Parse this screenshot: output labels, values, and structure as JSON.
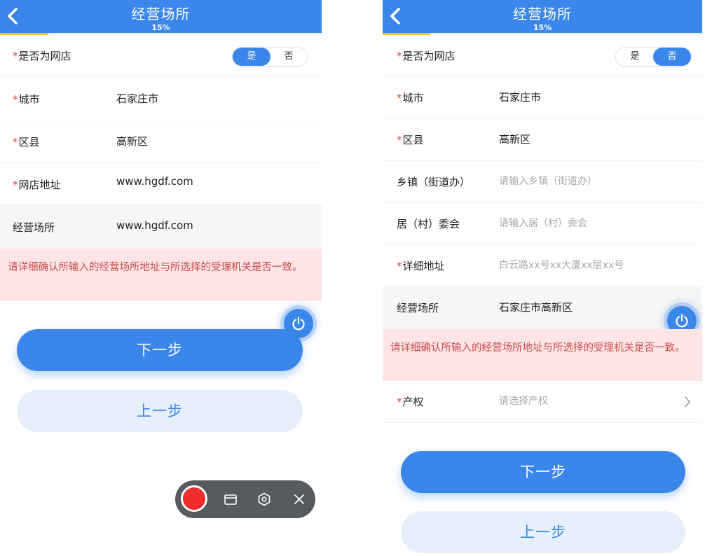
{
  "left": {
    "header": {
      "title": "经营场所",
      "progress_text": "15%",
      "progress_value": 0.15
    },
    "online_store": {
      "label": "是否为网店",
      "options": [
        "是",
        "否"
      ],
      "selected": "是"
    },
    "rows": [
      {
        "label": "城市",
        "required": true,
        "value": "石家庄市"
      },
      {
        "label": "区县",
        "required": true,
        "value": "高新区"
      },
      {
        "label": "网店地址",
        "required": true,
        "value": "www.hgdf.com"
      },
      {
        "label": "经营场所",
        "required": false,
        "value": "www.hgdf.com"
      }
    ],
    "warning": "请详细确认所输入的经营场所地址与所选择的受理机关是否一致。",
    "buttons": {
      "next": "下一步",
      "prev": "上一步"
    }
  },
  "right": {
    "header": {
      "title": "经营场所",
      "progress_text": "15%",
      "progress_value": 0.15
    },
    "online_store": {
      "label": "是否为网店",
      "options": [
        "是",
        "否"
      ],
      "selected": "否"
    },
    "rows": [
      {
        "label": "城市",
        "required": true,
        "value": "石家庄市"
      },
      {
        "label": "区县",
        "required": true,
        "value": "高新区"
      },
      {
        "label": "乡镇（街道办）",
        "required": false,
        "placeholder": "请输入乡镇（街道办）"
      },
      {
        "label": "居（村）委会",
        "required": false,
        "placeholder": "请输入居（村）委会"
      },
      {
        "label": "详细地址",
        "required": true,
        "placeholder": "白云路xx号xx大厦xx层xx号"
      },
      {
        "label": "经营场所",
        "required": false,
        "value": "石家庄市高新区"
      }
    ],
    "warning": "请详细确认所输入的经营场所地址与所选择的受理机关是否一致。",
    "property": {
      "label": "产权",
      "required": true,
      "placeholder": "请选择产权"
    },
    "buttons": {
      "next": "下一步",
      "prev": "上一步"
    }
  },
  "required_mark": "*",
  "icons": {
    "back": "chevron-left-icon",
    "power": "power-icon",
    "chevron": "chevron-right-icon",
    "folder": "folder-icon",
    "settings": "hexagon-settings-icon",
    "close": "close-icon",
    "record": "record-icon"
  },
  "colors": {
    "primary": "#3b86ea",
    "progress": "#f3c12f",
    "required": "#e33b3b",
    "warning_bg": "#fde5e5",
    "warning_text": "#c94b4b",
    "record": "#ef2d2d",
    "recorder_bg": "#575b60"
  }
}
